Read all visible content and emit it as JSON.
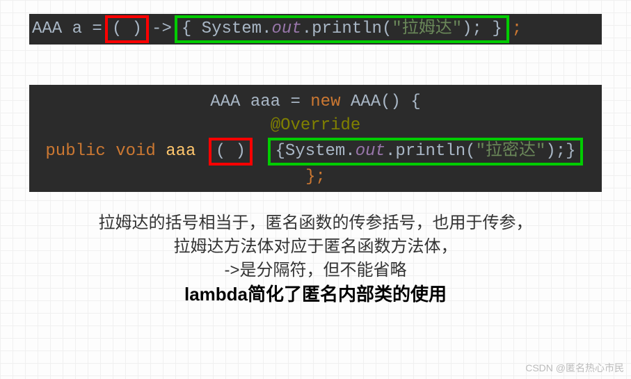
{
  "block1": {
    "decl": "AAA a = ",
    "paren": "( )",
    "arrow": " -> ",
    "body_open": "{  ",
    "sys": "System.",
    "out": "out",
    "println": ".println(",
    "str": "\"拉姆达\"",
    "body_close": ");  }",
    "semi": ";"
  },
  "block2": {
    "l1_a": "AAA aaa = ",
    "l1_new": "new",
    "l1_b": " AAA() ",
    "l1_brace": "{",
    "l2_override": "@Override",
    "l3_pub": "public void",
    "l3_name": " aaa",
    "l3_paren": "( )",
    "l3_body_open": "{",
    "l3_sys": "System.",
    "l3_out": "out",
    "l3_println": ".println(",
    "l3_str": "\"拉密达\"",
    "l3_body_close": ");}",
    "l4_close": "};"
  },
  "desc": {
    "l1": "拉姆达的括号相当于，匿名函数的传参括号，也用于传参，",
    "l2": "拉姆达方法体对应于匿名函数方法体，",
    "l3": "->是分隔符，但不能省略",
    "l4": "lambda简化了匿名内部类的使用"
  },
  "watermark": "CSDN @匿名热心市民"
}
